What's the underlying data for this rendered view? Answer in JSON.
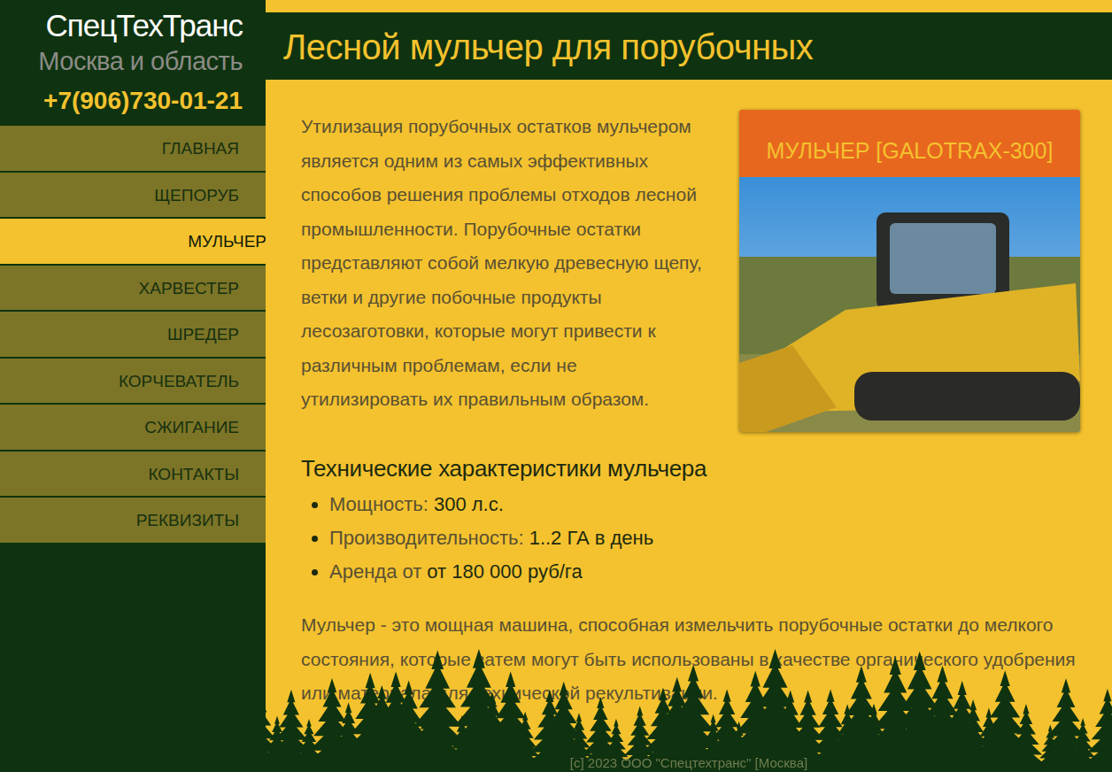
{
  "brand": {
    "name": "СпецТехТранс",
    "region": "Москва и область",
    "phone": "+7(906)730-01-21"
  },
  "nav": [
    {
      "label": "ГЛАВНАЯ",
      "selected": false
    },
    {
      "label": "ЩЕПОРУБ",
      "selected": false
    },
    {
      "label": "МУЛЬЧЕР",
      "selected": true
    },
    {
      "label": "ХАРВЕСТЕР",
      "selected": false
    },
    {
      "label": "ШРЕДЕР",
      "selected": false
    },
    {
      "label": "КОРЧЕВАТЕЛЬ",
      "selected": false
    },
    {
      "label": "СЖИГАНИЕ",
      "selected": false
    },
    {
      "label": "КОНТАКТЫ",
      "selected": false
    },
    {
      "label": "РЕКВИЗИТЫ",
      "selected": false
    }
  ],
  "page": {
    "title": "Лесной мульчер для порубочных"
  },
  "intro": "Утилизация порубочных остатков мульчером является одним из самых эффективных способов решения проблемы отходов лесной промышленности. Порубочные остатки представляют собой мелкую древесную щепу, ветки и другие побочные продукты лесозаготовки, которые могут привести к различным проблемам, если не утилизировать их правильным образом.",
  "card": {
    "title": "МУЛЬЧЕР [GALOTRAX-300]"
  },
  "specs": {
    "heading": "Технические характеристики мульчера",
    "items": [
      {
        "label": "Мощность:",
        "value": "300 л.с."
      },
      {
        "label": "Производительность:",
        "value": "1..2 ГА в день"
      },
      {
        "label": "Аренда от",
        "value": "от 180 000 руб/га"
      }
    ]
  },
  "description": "Мульчер - это мощная машина, способная измельчить порубочные остатки до мелкого состояния, которые затем могут быть использованы в качестве органического удобрения или материала для технической рекультивации.",
  "footer": "[c] 2023 ООО \"Спецтехтранс\" [Москва]"
}
